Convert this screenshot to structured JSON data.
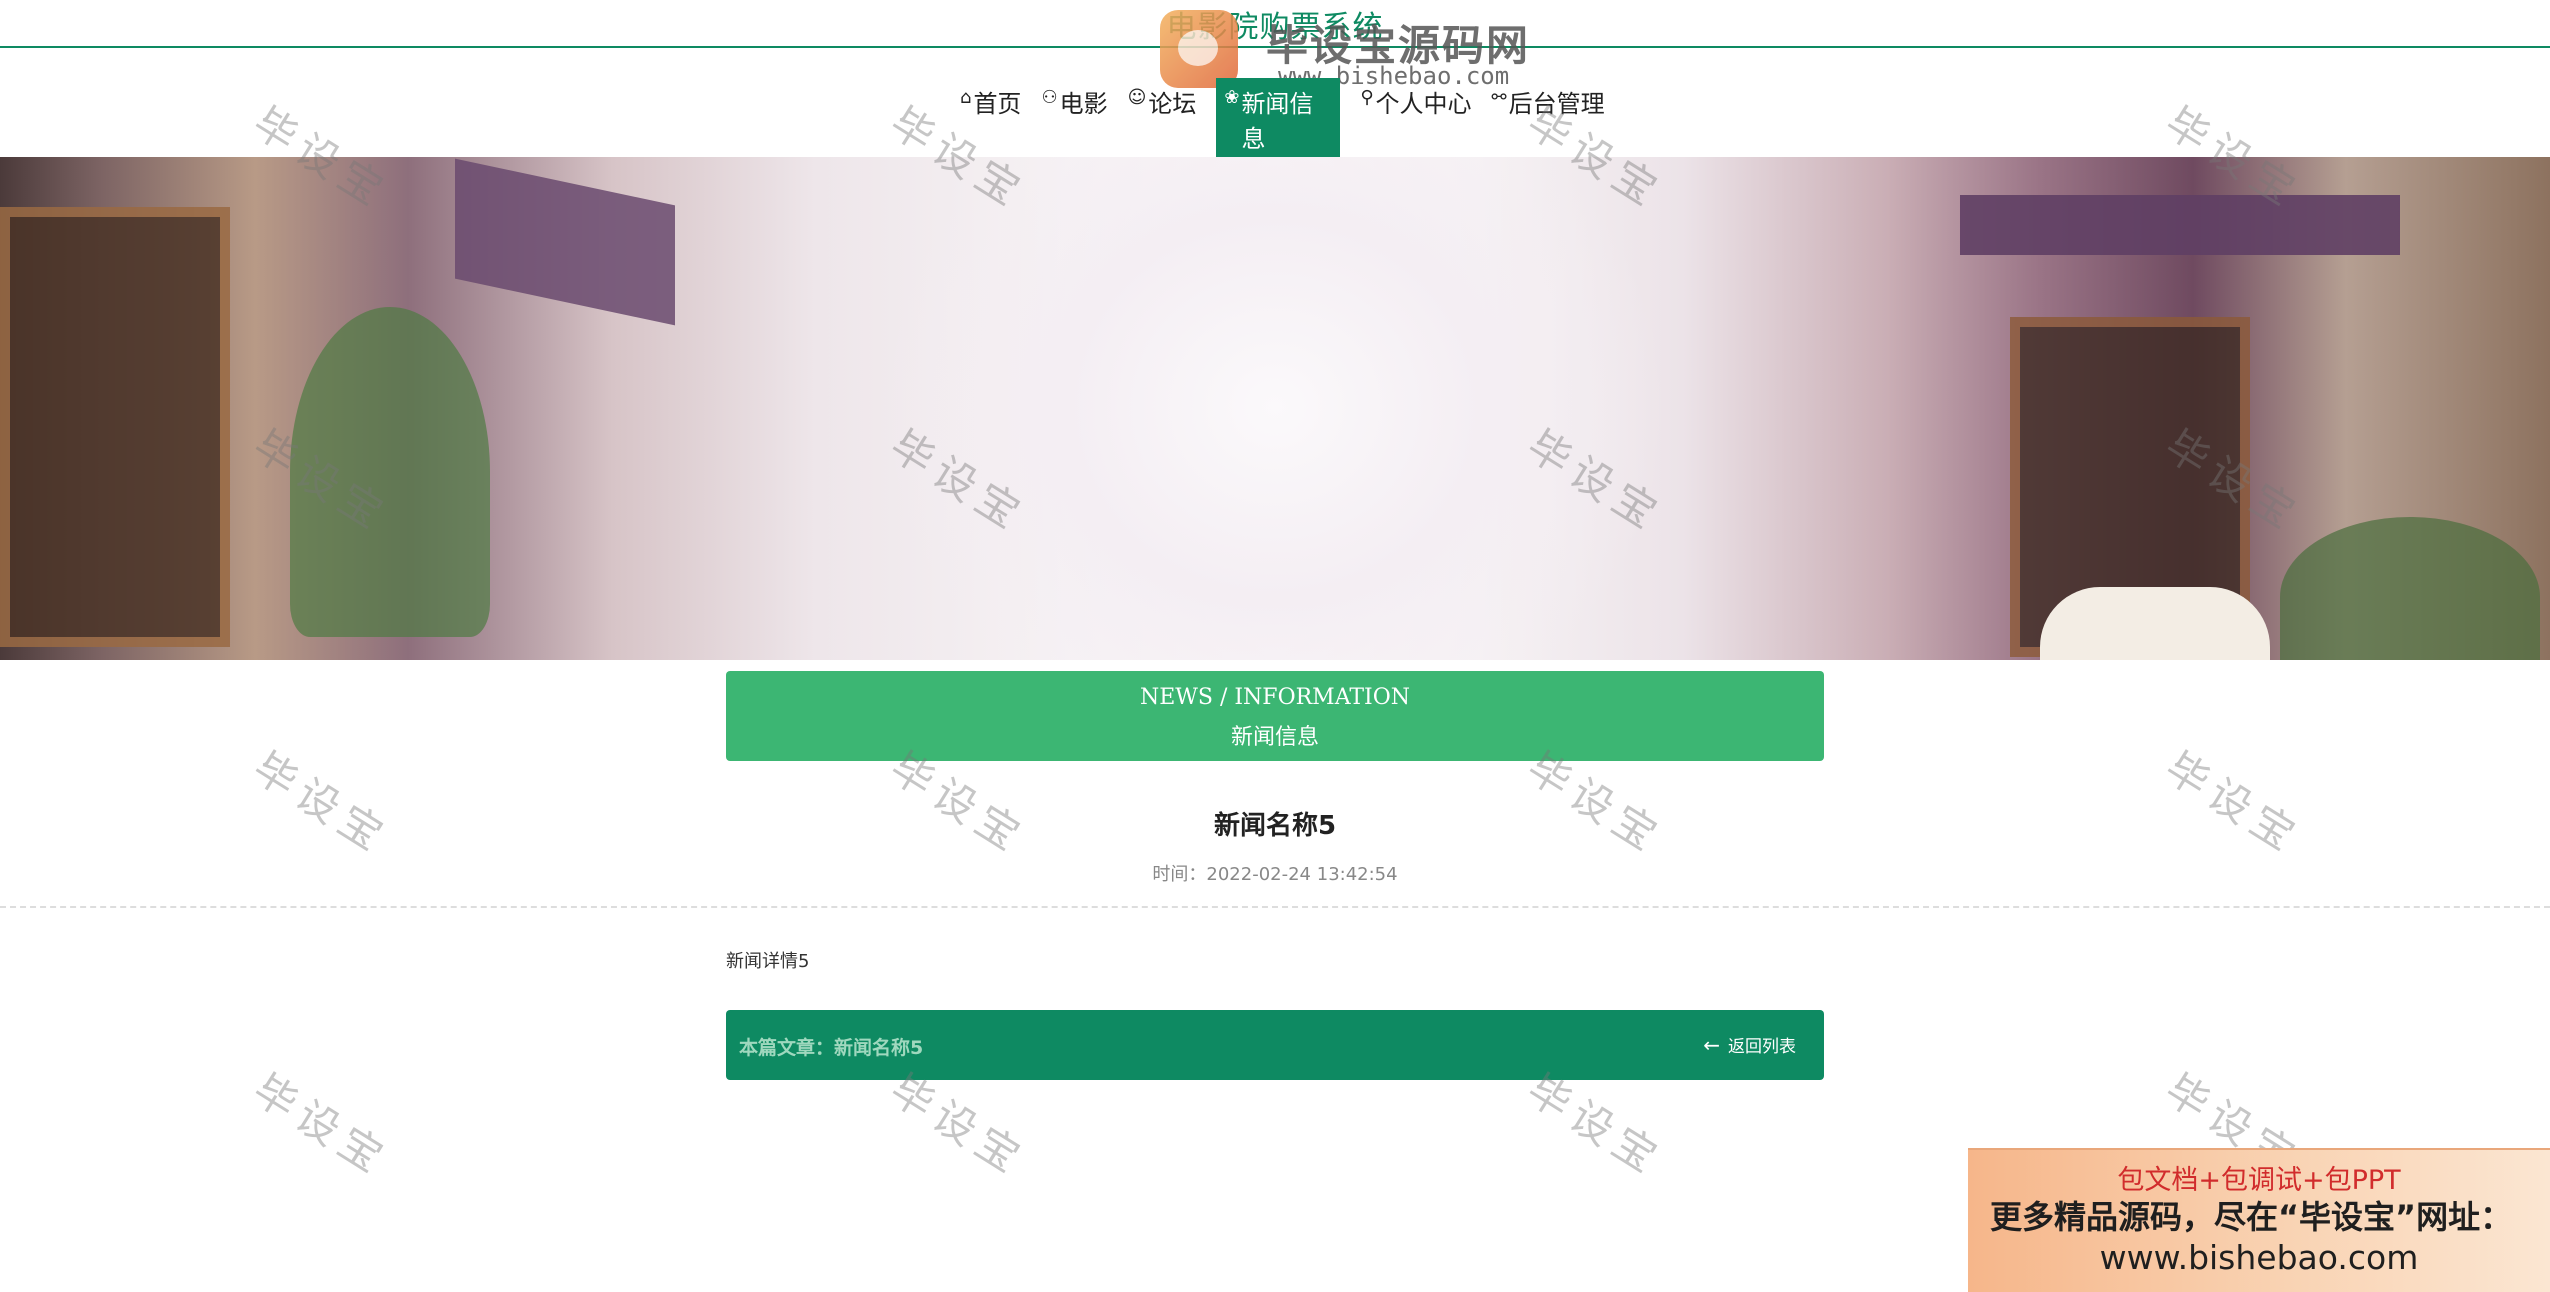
{
  "site": {
    "title": "电影院购票系统"
  },
  "logo": {
    "brand": "毕设宝源码网",
    "url": "www.bishebao.com"
  },
  "nav": [
    {
      "icon": "⌂",
      "icon_name": "home-icon",
      "label": "首页",
      "active": false
    },
    {
      "icon": "⚇",
      "icon_name": "film-icon",
      "label": "电影",
      "active": false
    },
    {
      "icon": "☺",
      "icon_name": "forum-icon",
      "label": "论坛",
      "active": false
    },
    {
      "icon": "❀",
      "icon_name": "news-icon",
      "label": "新闻信息",
      "active": true
    },
    {
      "icon": "⚲",
      "icon_name": "user-icon",
      "label": "个人中心",
      "active": false
    },
    {
      "icon": "⚯",
      "icon_name": "link-icon",
      "label": "后台管理",
      "active": false
    }
  ],
  "carousel": {
    "slide_count": 3,
    "active_index": 0
  },
  "section": {
    "title_en": "NEWS / INFORMATION",
    "title_cn": "新闻信息"
  },
  "article": {
    "title": "新闻名称5",
    "time_label": "时间：",
    "time": "2022-02-24 13:42:54",
    "body": "新闻详情5",
    "current_label": "本篇文章：",
    "current_title": "新闻名称5",
    "back_icon": "←",
    "back_label": "返回列表"
  },
  "watermark": {
    "text": "毕设宝"
  },
  "ad": {
    "line1": "包文档+包调试+包PPT",
    "line2": "更多精品源码，尽在“毕设宝”网址：",
    "line3": "www.bishebao.com"
  },
  "colors": {
    "primary": "#0e8a62",
    "section": "#3cb673",
    "ad_red": "#d12c2c"
  }
}
